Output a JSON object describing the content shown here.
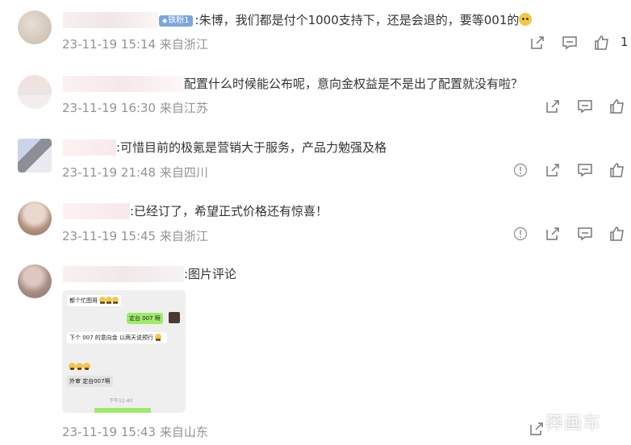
{
  "comments": [
    {
      "badge": "铁粉1",
      "text": ":朱博，我们都是付个1000支持下，还是会退的，要等001的",
      "time": "23-11-19 15:14 来自浙江",
      "likes": "1"
    },
    {
      "text": "配置什么时候能公布呢，意向金权益是不是出了配置就没有啦？",
      "time": "23-11-19 16:30 来自江苏"
    },
    {
      "text": ":可惜目前的极氪是营销大于服务，产品力勉强及格",
      "time": "23-11-19 21:48 来自四川"
    },
    {
      "text": ":已经订了，希望正式价格还有惊喜！",
      "time": "23-11-19 15:45 来自浙江"
    },
    {
      "text": ":图片评论",
      "time": "23-11-19 15:43 来自山东",
      "image": {
        "msg1": "都个忙图哥",
        "msg2": "定台 007 啊",
        "msg3a": "下个 007 的意向金 以两天说预行",
        "msg4": "外审 定台007啊",
        "footer": "下午11:40"
      }
    }
  ],
  "watermark": "莽画车",
  "icons": [
    "share-icon",
    "comment-icon",
    "like-icon",
    "report-icon"
  ]
}
